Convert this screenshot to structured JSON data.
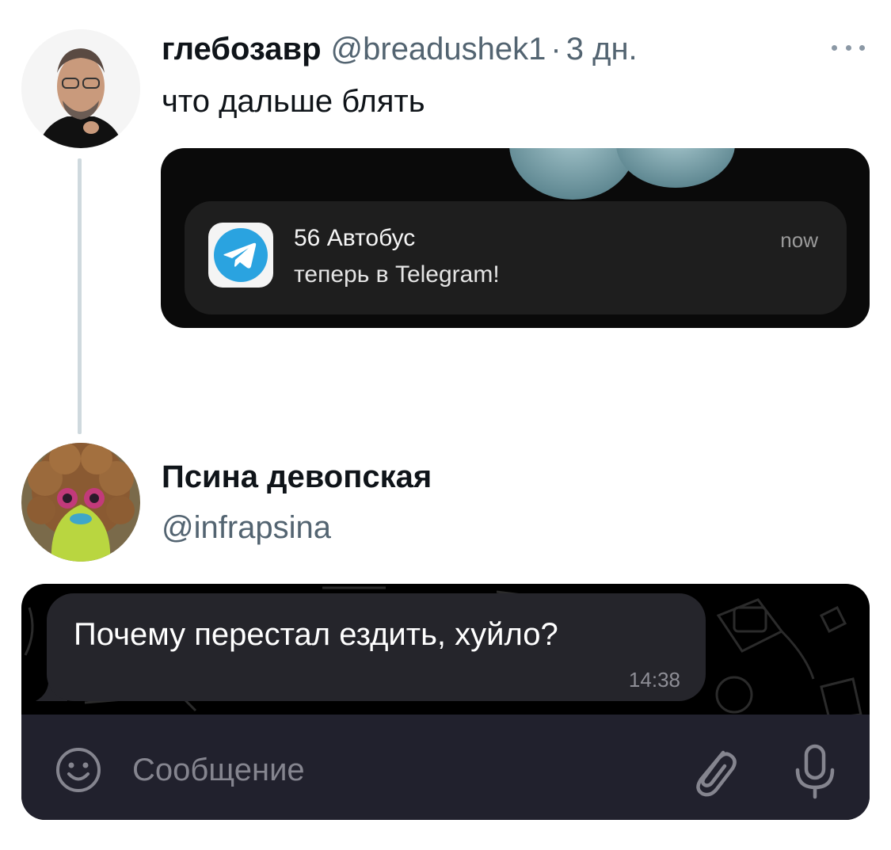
{
  "tweet": {
    "author": {
      "display_name": "глебозавр",
      "handle": "@breadushek1",
      "separator": "·",
      "time": "3 дн."
    },
    "text": "что дальше блять",
    "menu_icon": "more-dots-icon",
    "media": {
      "notification": {
        "app_icon": "telegram-icon",
        "title": "56 Автобус",
        "body": "теперь в Telegram!",
        "time": "now"
      }
    }
  },
  "reply": {
    "author": {
      "display_name": "Псина девопская",
      "handle": "@infrapsina"
    },
    "media": {
      "chat": {
        "message_text": "Почему перестал ездить, хуйло?",
        "message_time": "14:38",
        "input_placeholder": "Сообщение",
        "icons": [
          "emoji-icon",
          "attach-icon",
          "mic-icon"
        ]
      }
    }
  },
  "colors": {
    "text_primary": "#0f1419",
    "text_secondary": "#536471",
    "thread_line": "#cfd9de",
    "telegram_blue": "#2aa3e0",
    "chat_bubble": "#25252b",
    "chat_input_bar": "#21212d"
  }
}
